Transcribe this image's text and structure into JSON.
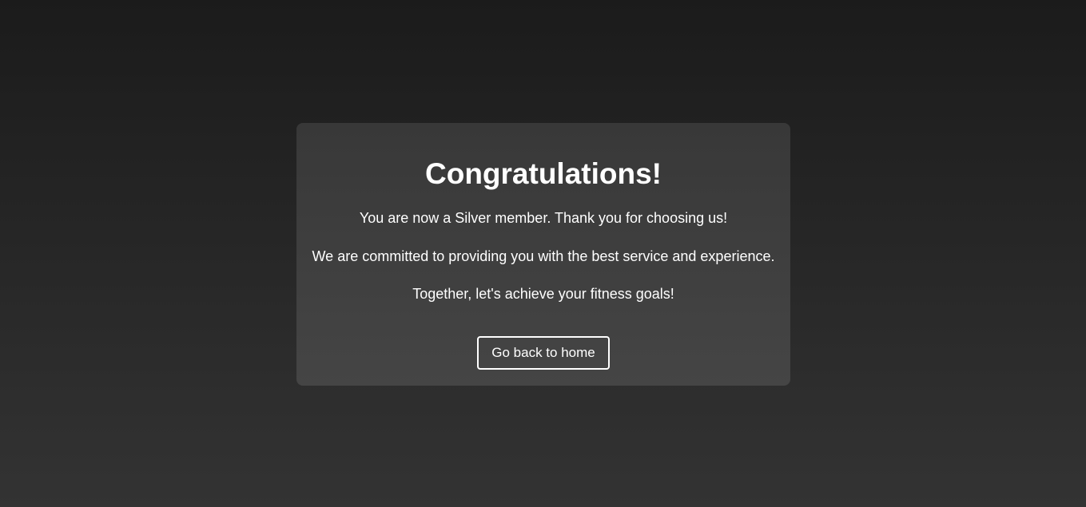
{
  "card": {
    "title": "Congratulations!",
    "messages": [
      "You are now a Silver member. Thank you for choosing us!",
      "We are committed to providing you with the best service and experience.",
      "Together, let's achieve your fitness goals!"
    ],
    "button_label": "Go back to home"
  },
  "colors": {
    "background_top": "#1b1b1b",
    "background_bottom": "#333333",
    "card_top": "#383838",
    "card_bottom": "#454545",
    "text": "#ffffff",
    "button_border": "#ffffff"
  }
}
